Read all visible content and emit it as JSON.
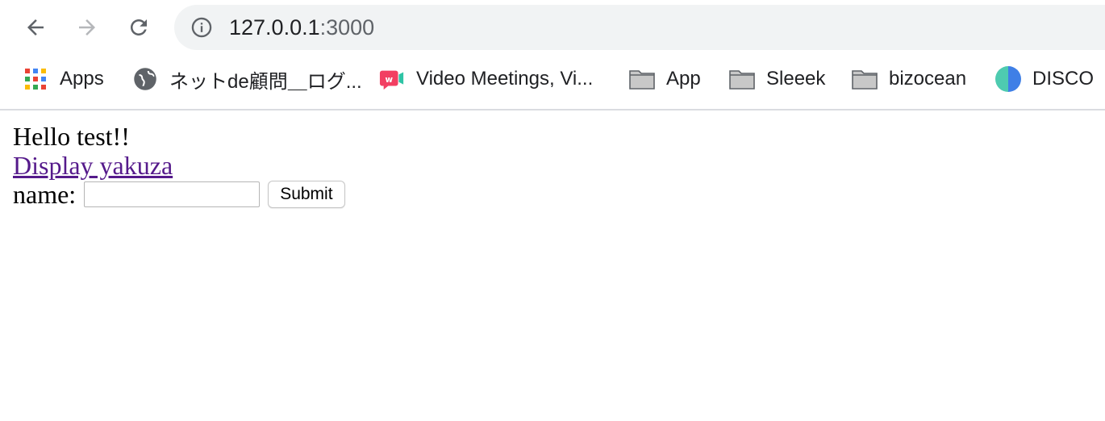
{
  "browser": {
    "url_host": "127.0.0.1",
    "url_port": ":3000",
    "bookmarks": [
      {
        "label": "Apps",
        "icon": "apps-grid-icon"
      },
      {
        "label": "ネットde顧問＿ログ...",
        "icon": "globe-icon"
      },
      {
        "label": "Video Meetings, Vi...",
        "icon": "whereby-icon"
      },
      {
        "label": "App",
        "icon": "folder-icon"
      },
      {
        "label": "Sleeek",
        "icon": "folder-icon"
      },
      {
        "label": "bizocean",
        "icon": "folder-icon"
      },
      {
        "label": "DISCO",
        "icon": "disco-icon"
      }
    ]
  },
  "page": {
    "greeting": "Hello test!!",
    "link_text": "Display yakuza",
    "form": {
      "name_label": "name:",
      "name_value": "",
      "submit_label": "Submit"
    }
  },
  "colors": {
    "link_visited": "#551a8b",
    "omnibox_bg": "#f1f3f4",
    "toolbar_icon": "#5f6368"
  }
}
